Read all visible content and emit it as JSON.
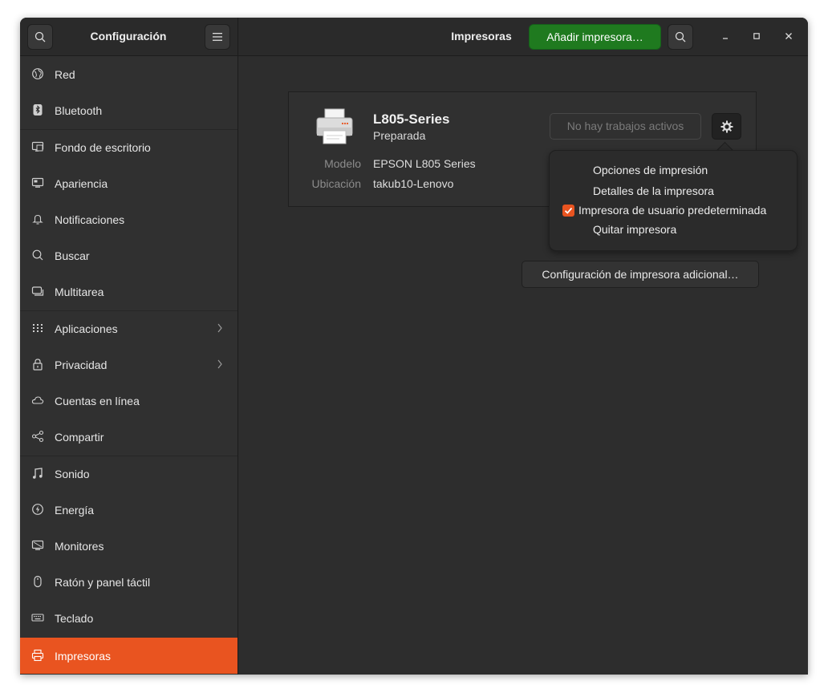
{
  "header": {
    "app_title": "Configuración",
    "page_title": "Impresoras",
    "add_button": "Añadir impresora…"
  },
  "sidebar": {
    "items": [
      {
        "label": "Red",
        "icon": "globe-icon"
      },
      {
        "label": "Bluetooth",
        "icon": "bluetooth-icon"
      },
      {
        "label": "Fondo de escritorio",
        "icon": "desktop-background-icon"
      },
      {
        "label": "Apariencia",
        "icon": "appearance-icon"
      },
      {
        "label": "Notificaciones",
        "icon": "bell-icon"
      },
      {
        "label": "Buscar",
        "icon": "search-icon"
      },
      {
        "label": "Multitarea",
        "icon": "multitasking-icon"
      },
      {
        "label": "Aplicaciones",
        "icon": "apps-grid-icon"
      },
      {
        "label": "Privacidad",
        "icon": "lock-icon"
      },
      {
        "label": "Cuentas en línea",
        "icon": "cloud-icon"
      },
      {
        "label": "Compartir",
        "icon": "share-icon"
      },
      {
        "label": "Sonido",
        "icon": "music-note-icon"
      },
      {
        "label": "Energía",
        "icon": "power-icon"
      },
      {
        "label": "Monitores",
        "icon": "monitor-icon"
      },
      {
        "label": "Ratón y panel táctil",
        "icon": "mouse-icon"
      },
      {
        "label": "Teclado",
        "icon": "keyboard-icon"
      },
      {
        "label": "Impresoras",
        "icon": "printer-icon"
      }
    ]
  },
  "printer": {
    "name": "L805-Series",
    "status": "Preparada",
    "model_label": "Modelo",
    "model_value": "EPSON L805 Series",
    "location_label": "Ubicación",
    "location_value": "takub10-Lenovo",
    "jobs_button": "No hay trabajos activos"
  },
  "menu": {
    "print_options": "Opciones de impresión",
    "printer_details": "Detalles de la impresora",
    "default_printer": "Impresora de usuario predeterminada",
    "remove_printer": "Quitar impresora"
  },
  "extra_button": "Configuración de impresora adicional…",
  "colors": {
    "accent": "#e95420",
    "add_button": "#1f7a1f"
  }
}
